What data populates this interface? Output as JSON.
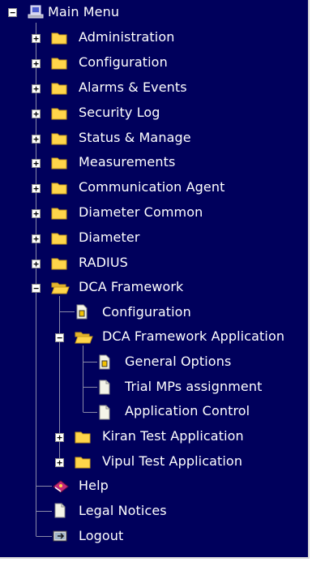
{
  "colors": {
    "background": "#00005c",
    "text": "#ffffff",
    "folder": "#ffd54a",
    "tree_line": "#8a8aa8"
  },
  "tree": {
    "root": {
      "label": "Main Menu",
      "icon": "computer-icon",
      "toggle": "−"
    },
    "items": [
      {
        "label": "Administration",
        "icon": "folder-icon",
        "toggle": "+"
      },
      {
        "label": "Configuration",
        "icon": "folder-icon",
        "toggle": "+"
      },
      {
        "label": "Alarms & Events",
        "icon": "folder-icon",
        "toggle": "+"
      },
      {
        "label": "Security Log",
        "icon": "folder-icon",
        "toggle": "+"
      },
      {
        "label": "Status & Manage",
        "icon": "folder-icon",
        "toggle": "+"
      },
      {
        "label": "Measurements",
        "icon": "folder-icon",
        "toggle": "+"
      },
      {
        "label": "Communication Agent",
        "icon": "folder-icon",
        "toggle": "+"
      },
      {
        "label": "Diameter Common",
        "icon": "folder-icon",
        "toggle": "+"
      },
      {
        "label": "Diameter",
        "icon": "folder-icon",
        "toggle": "+"
      },
      {
        "label": "RADIUS",
        "icon": "folder-icon",
        "toggle": "+"
      },
      {
        "label": "DCA Framework",
        "icon": "open-folder-icon",
        "toggle": "−",
        "children": [
          {
            "label": "Configuration",
            "icon": "config-page-icon"
          },
          {
            "label": "DCA Framework Application",
            "icon": "open-folder-icon",
            "toggle": "−",
            "children": [
              {
                "label": "General Options",
                "icon": "config-page-icon"
              },
              {
                "label": "Trial MPs assignment",
                "icon": "page-icon"
              },
              {
                "label": "Application Control",
                "icon": "page-icon"
              }
            ]
          },
          {
            "label": "Kiran Test Application",
            "icon": "folder-icon",
            "toggle": "+"
          },
          {
            "label": "Vipul Test Application",
            "icon": "folder-icon",
            "toggle": "+"
          }
        ]
      },
      {
        "label": "Help",
        "icon": "help-book-icon"
      },
      {
        "label": "Legal Notices",
        "icon": "page-icon"
      },
      {
        "label": "Logout",
        "icon": "logout-icon"
      }
    ]
  }
}
